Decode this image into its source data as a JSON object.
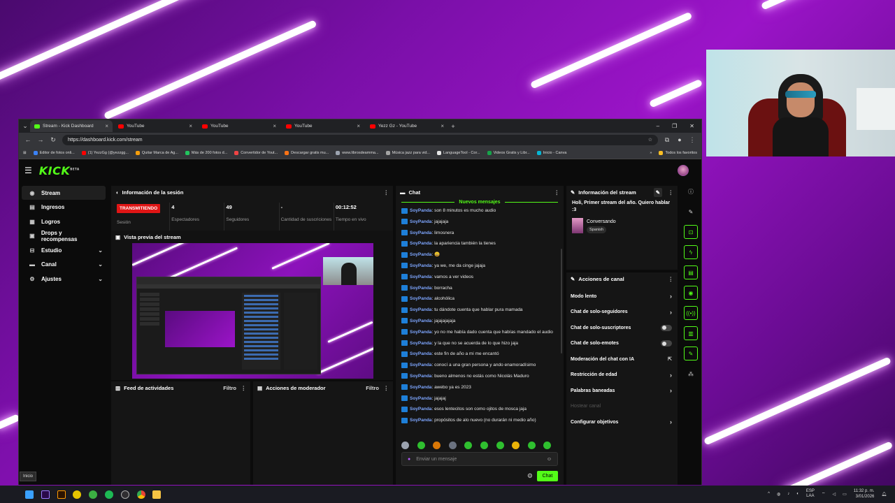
{
  "browser": {
    "tabs": [
      {
        "title": "Stream - Kick Dashboard",
        "active": true,
        "favicon_color": "#53fc18"
      },
      {
        "title": "YouTube",
        "active": false,
        "favicon_color": "#ff0000"
      },
      {
        "title": "YouTube",
        "active": false,
        "favicon_color": "#ff0000"
      },
      {
        "title": "YouTube",
        "active": false,
        "favicon_color": "#ff0000"
      },
      {
        "title": "Yezz Gz - YouTube",
        "active": false,
        "favicon_color": "#ff0000"
      }
    ],
    "url": "https://dashboard.kick.com/stream",
    "bookmarks": [
      "Editor de fotos onli...",
      "(1) YezzGg (@yezzgg...",
      "Quitar Marca de Ag...",
      "Más de 200 fotos d...",
      "Convertidor de Yout...",
      "Descargar gratis mu...",
      "www.librosdeamma...",
      "Música jazz para vid...",
      "LanguageTool - Cor...",
      "Videos Gratis y Libr...",
      "Inicio - Canva"
    ],
    "bookmarks_more": "Todos los favoritos"
  },
  "kick": {
    "logo": "KICK",
    "logo_sup": "BETA",
    "accent": "#53fc18",
    "sidebar": [
      {
        "label": "Stream",
        "icon": "stream-icon",
        "active": true,
        "expandable": false
      },
      {
        "label": "Ingresos",
        "icon": "revenue-icon",
        "active": false,
        "expandable": false
      },
      {
        "label": "Logros",
        "icon": "achievements-icon",
        "active": false,
        "expandable": false
      },
      {
        "label": "Drops y recompensas",
        "icon": "drops-icon",
        "active": false,
        "expandable": false
      },
      {
        "label": "Estudio",
        "icon": "studio-icon",
        "active": false,
        "expandable": true
      },
      {
        "label": "Canal",
        "icon": "channel-icon",
        "active": false,
        "expandable": true
      },
      {
        "label": "Ajustes",
        "icon": "gear-icon",
        "active": false,
        "expandable": true
      }
    ],
    "session": {
      "title": "Información de la sesión",
      "status": "TRANSMITIENDO",
      "status_color": "#e01515",
      "status_label": "Sesión",
      "stats": [
        {
          "value": "4",
          "label": "Espectadores"
        },
        {
          "value": "49",
          "label": "Seguidores"
        },
        {
          "value": "-",
          "label": "Cantidad de suscriciones"
        },
        {
          "value": "00:12:52",
          "label": "Tiempo en vivo"
        }
      ]
    },
    "preview": {
      "title": "Vista previa del stream"
    },
    "activity": {
      "title": "Feed de actividades",
      "filter": "Filtro"
    },
    "moderator": {
      "title": "Acciones de moderador",
      "filter": "Filtro"
    },
    "chat": {
      "title": "Chat",
      "new_messages": "Nuevos mensajes",
      "messages": [
        {
          "user": "SoyPanda",
          "text": "son 8 minutos es mucho audio"
        },
        {
          "user": "SoyPanda",
          "text": "jajajaja"
        },
        {
          "user": "SoyPanda",
          "text": "limosnera"
        },
        {
          "user": "SoyPanda",
          "text": "la apariencia también la tienes"
        },
        {
          "user": "SoyPanda",
          "text": "😄"
        },
        {
          "user": "SoyPanda",
          "text": "ya we, me da cinge jajaja"
        },
        {
          "user": "SoyPanda",
          "text": "vamos a ver videos"
        },
        {
          "user": "SoyPanda",
          "text": "borracha"
        },
        {
          "user": "SoyPanda",
          "text": "alcohólica"
        },
        {
          "user": "SoyPanda",
          "text": "tu dándote cuenta que hablar pura mamada"
        },
        {
          "user": "SoyPanda",
          "text": "jajajajajaja"
        },
        {
          "user": "SoyPanda",
          "text": "yo no me había dado cuenta que habías mandado el audio"
        },
        {
          "user": "SoyPanda",
          "text": "y la que no se acuerda de lo que hizo jaja"
        },
        {
          "user": "SoyPanda",
          "text": "este fin de año a mi me encantó"
        },
        {
          "user": "SoyPanda",
          "text": "conocí a una gran persona y ando enamoradísimo"
        },
        {
          "user": "SoyPanda",
          "text": "bueno almenos no estás como Nicolás Maduro"
        },
        {
          "user": "SoyPanda",
          "text": "awebo ya es 2023"
        },
        {
          "user": "SoyPanda",
          "text": "jajajaj"
        },
        {
          "user": "SoyPanda",
          "text": "esos lentecitos son como ojitos de mosca jaja"
        },
        {
          "user": "SoyPanda",
          "text": "propósitos de alo nuevo (no durarán ni medio año)"
        }
      ],
      "input_placeholder": "Enviar un mensaje",
      "send_label": "Chat"
    },
    "stream_info": {
      "title": "Información del stream",
      "stream_title": "Holi, Primer stream del año. Quiero hablar :3",
      "category": "Conversando",
      "language_tag": "Spanish"
    },
    "channel_actions": {
      "title": "Acciones de canal",
      "items": [
        {
          "label": "Modo lento",
          "control": "chevron"
        },
        {
          "label": "Chat de solo-seguidores",
          "control": "chevron"
        },
        {
          "label": "Chat de solo-suscriptores",
          "control": "toggle",
          "value": false
        },
        {
          "label": "Chat de solo-emotes",
          "control": "toggle",
          "value": false
        },
        {
          "label": "Moderación del chat con IA",
          "control": "external"
        },
        {
          "label": "Restricción de edad",
          "control": "chevron"
        },
        {
          "label": "Palabras baneadas",
          "control": "chevron"
        },
        {
          "label": "Hostear canal",
          "control": "none",
          "disabled": true
        },
        {
          "label": "Configurar objetivos",
          "control": "chevron"
        }
      ]
    }
  },
  "tooltip": "Inicio",
  "taskbar": {
    "lang_line1": "ESP",
    "lang_line2": "LAA",
    "time": "11:32 p. m.",
    "date": "3/01/2026"
  }
}
